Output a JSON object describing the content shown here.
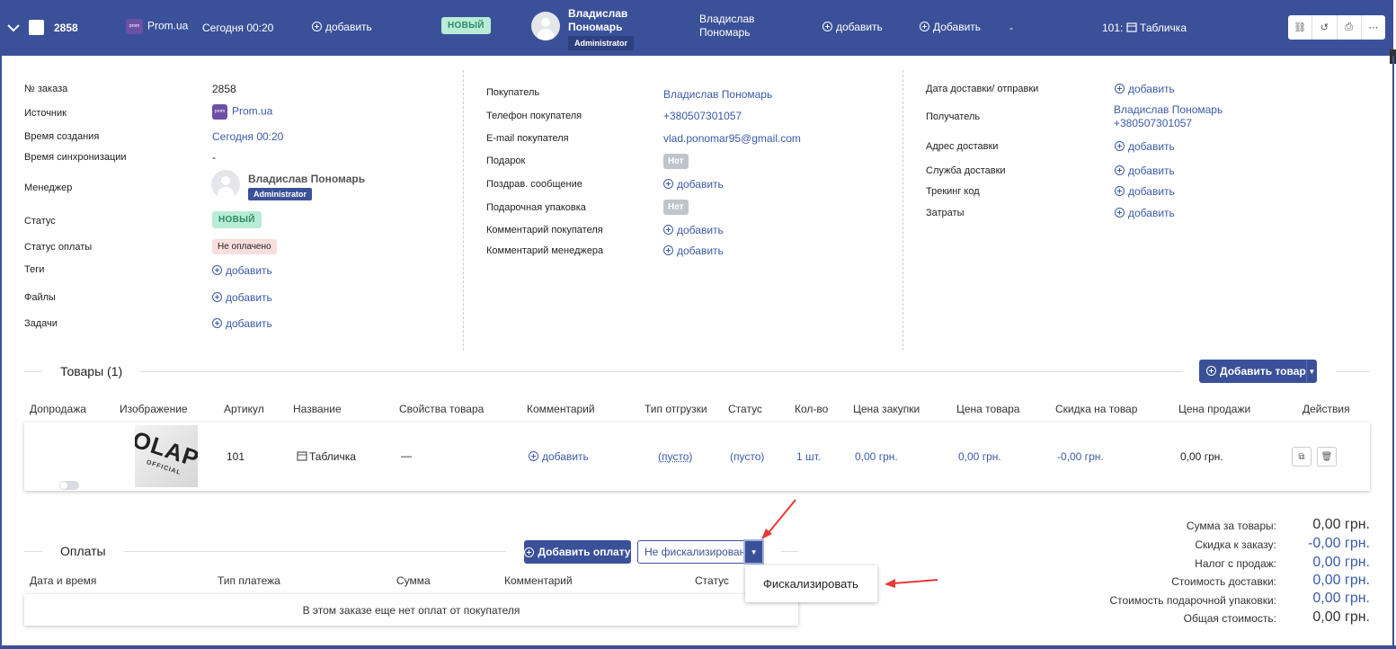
{
  "header": {
    "order_number": "2858",
    "source": "Prom.ua",
    "source_logo": "prom",
    "created": "Сегодня 00:20",
    "add_1": "добавить",
    "status": "НОВЫЙ",
    "manager_name": "Владислав Пономарь",
    "manager_name_l1": "Владислав",
    "manager_name_l2": "Пономарь",
    "manager_role": "Administrator",
    "buyer_l1": "Владислав",
    "buyer_l2": "Пономарь",
    "add_2": "добавить",
    "add_3": "Добавить",
    "dash": "-",
    "product_ref": "101:",
    "product_name": "Табличка",
    "colors": {
      "bar": "#3a5199",
      "accent": "#3a5aa8",
      "new_badge": "#b8ecd6"
    }
  },
  "left_panel": {
    "order_no_label": "№ заказа",
    "order_no": "2858",
    "source_label": "Источник",
    "source": "Prom.ua",
    "created_label": "Время создания",
    "created": "Сегодня 00:20",
    "sync_label": "Время синхронизации",
    "sync": "-",
    "manager_label": "Менеджер",
    "manager": "Владислав Пономарь",
    "manager_role": "Administrator",
    "status_label": "Статус",
    "status": "НОВЫЙ",
    "pay_status_label": "Статус оплаты",
    "pay_status": "Не оплачено",
    "tags_label": "Теги",
    "files_label": "Файлы",
    "tasks_label": "Задачи",
    "add": "добавить"
  },
  "mid_panel": {
    "buyer_label": "Покупатель",
    "buyer": "Владислав Пономарь",
    "phone_label": "Телефон покупателя",
    "phone": "+380507301057",
    "email_label": "E-mail покупателя",
    "email": "vlad.ponomar95@gmail.com",
    "gift_label": "Подарок",
    "gift": "Нет",
    "greeting_label": "Поздрав. сообщение",
    "wrap_label": "Подарочная упаковка",
    "wrap": "Нет",
    "buyer_comment_label": "Комментарий покупателя",
    "manager_comment_label": "Комментарий менеджера",
    "add": "добавить"
  },
  "right_panel": {
    "delivery_date_label": "Дата доставки/ отправки",
    "recipient_label": "Получатель",
    "recipient_name": "Владислав Пономарь",
    "recipient_phone": "+380507301057",
    "address_label": "Адрес доставки",
    "service_label": "Служба доставки",
    "tracking_label": "Трекинг код",
    "costs_label": "Затраты",
    "add": "добавить"
  },
  "products": {
    "title": "Товары (1)",
    "add_button": "Добавить товар",
    "columns": [
      "Допродажа",
      "Изображение",
      "Артикул",
      "Название",
      "Свойства товара",
      "Комментарий",
      "Тип отгрузки",
      "Статус",
      "Кол-во",
      "Цена закупки",
      "Цена товара",
      "Скидка на товар",
      "Цена продажи",
      "Действия"
    ],
    "row": {
      "sku": "101",
      "name": "Табличка",
      "props": "—",
      "comment": "добавить",
      "ship_type": "(пусто)",
      "status": "(пусто)",
      "qty": "1 шт.",
      "purchase": "0,00 грн.",
      "price": "0,00 грн.",
      "discount": "-0,00 грн.",
      "sale": "0,00 грн.",
      "image_text": "OLAPL",
      "image_subtext": "OFFICIAL"
    }
  },
  "payments": {
    "title": "Оплаты",
    "add_button": "Добавить оплату",
    "fiscal_status": "Не фискализирован",
    "fiscal_menu_item": "Фискализировать",
    "columns": [
      "Дата и время",
      "Тип платежа",
      "Сумма",
      "Комментарий",
      "Статус"
    ],
    "empty": "В этом заказе еще нет оплат от покупателя"
  },
  "totals": {
    "goods_label": "Сумма за товары:",
    "goods": "0,00 грн.",
    "discount_label": "Скидка к заказу:",
    "discount": "-0,00 грн.",
    "tax_label": "Налог с продаж:",
    "tax": "0,00 грн.",
    "delivery_label": "Стоимость доставки:",
    "delivery": "0,00 грн.",
    "wrap_label": "Стоимость подарочной упаковки:",
    "wrap": "0,00 грн.",
    "total_label": "Общая стоимость:",
    "total": "0,00 грн."
  }
}
